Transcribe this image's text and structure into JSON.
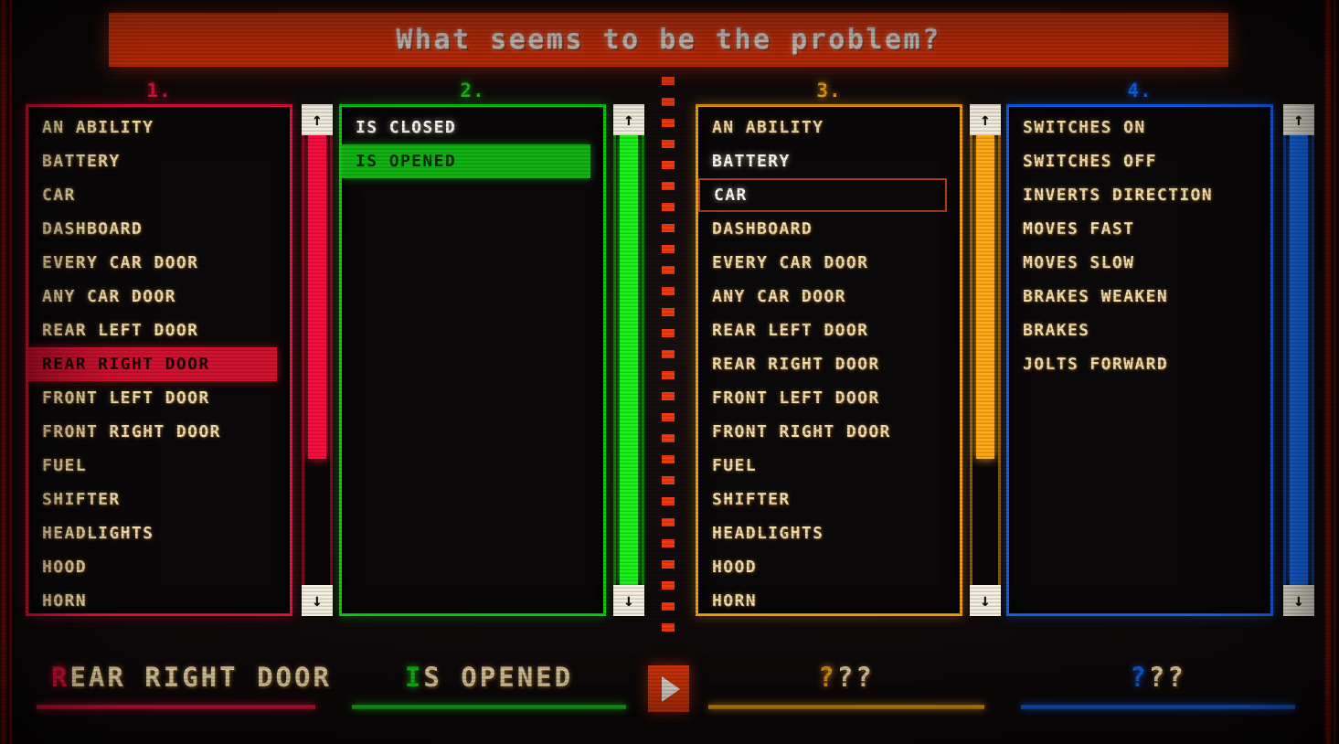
{
  "title": {
    "text": "What seems to be the problem?",
    "banner_color": "#ee3c10"
  },
  "columns": [
    {
      "number": "1.",
      "accent": "#e8123a",
      "thumb": "#f51040",
      "track_border": "#7c0a1e",
      "scroll_thumb_pct": 72,
      "items": [
        {
          "label": "AN ABILITY",
          "state": "normal"
        },
        {
          "label": "BATTERY",
          "state": "normal"
        },
        {
          "label": "CAR",
          "state": "normal"
        },
        {
          "label": "DASHBOARD",
          "state": "normal"
        },
        {
          "label": "EVERY CAR DOOR",
          "state": "normal"
        },
        {
          "label": "ANY CAR DOOR",
          "state": "normal"
        },
        {
          "label": "REAR LEFT DOOR",
          "state": "normal"
        },
        {
          "label": "REAR RIGHT DOOR",
          "state": "selected"
        },
        {
          "label": "FRONT LEFT DOOR",
          "state": "normal"
        },
        {
          "label": "FRONT RIGHT DOOR",
          "state": "normal"
        },
        {
          "label": "FUEL",
          "state": "normal"
        },
        {
          "label": "SHIFTER",
          "state": "normal"
        },
        {
          "label": "HEADLIGHTS",
          "state": "normal"
        },
        {
          "label": "HOOD",
          "state": "normal"
        },
        {
          "label": "HORN",
          "state": "normal"
        }
      ]
    },
    {
      "number": "2.",
      "accent": "#12c914",
      "thumb": "#1ef01e",
      "track_border": "#0a6b0b",
      "scroll_thumb_pct": 100,
      "items": [
        {
          "label": "IS CLOSED",
          "state": "bright"
        },
        {
          "label": "IS OPENED",
          "state": "selected"
        }
      ]
    },
    {
      "number": "3.",
      "accent": "#f0a010",
      "thumb": "#ffa91a",
      "track_border": "#8a5a06",
      "scroll_thumb_pct": 72,
      "items": [
        {
          "label": "AN ABILITY",
          "state": "normal"
        },
        {
          "label": "BATTERY",
          "state": "bright"
        },
        {
          "label": "CAR",
          "state": "hovered"
        },
        {
          "label": "DASHBOARD",
          "state": "normal"
        },
        {
          "label": "EVERY CAR DOOR",
          "state": "normal"
        },
        {
          "label": "ANY CAR DOOR",
          "state": "normal"
        },
        {
          "label": "REAR LEFT DOOR",
          "state": "normal"
        },
        {
          "label": "REAR RIGHT DOOR",
          "state": "normal"
        },
        {
          "label": "FRONT LEFT DOOR",
          "state": "normal"
        },
        {
          "label": "FRONT RIGHT DOOR",
          "state": "normal"
        },
        {
          "label": "FUEL",
          "state": "normal"
        },
        {
          "label": "SHIFTER",
          "state": "normal"
        },
        {
          "label": "HEADLIGHTS",
          "state": "normal"
        },
        {
          "label": "HOOD",
          "state": "normal"
        },
        {
          "label": "HORN",
          "state": "normal"
        }
      ]
    },
    {
      "number": "4.",
      "accent": "#1462e8",
      "thumb": "#1a6ef5",
      "track_border": "#0b3a8c",
      "scroll_thumb_pct": 100,
      "items": [
        {
          "label": "SWITCHES ON",
          "state": "normal"
        },
        {
          "label": "SWITCHES OFF",
          "state": "normal"
        },
        {
          "label": "INVERTS DIRECTION",
          "state": "normal"
        },
        {
          "label": "MOVES FAST",
          "state": "normal"
        },
        {
          "label": "MOVES SLOW",
          "state": "normal"
        },
        {
          "label": "BRAKES WEAKEN",
          "state": "normal"
        },
        {
          "label": "BRAKES",
          "state": "normal"
        },
        {
          "label": "JOLTS FORWARD",
          "state": "normal"
        }
      ]
    }
  ],
  "scrollbar": {
    "up_arrow": "↑",
    "down_arrow": "↓"
  },
  "divider": {
    "color": "#f03a10"
  },
  "play_button": {
    "label": "play-triangle",
    "color": "#e23a0c"
  },
  "answers": [
    {
      "lead": "R",
      "rest": "EAR RIGHT DOOR",
      "accent": "#e8123a"
    },
    {
      "lead": "I",
      "rest": "S OPENED",
      "accent": "#12c914"
    },
    {
      "lead": "?",
      "rest": "??",
      "accent": "#f0a010"
    },
    {
      "lead": "?",
      "rest": "??",
      "accent": "#1462e8"
    }
  ]
}
